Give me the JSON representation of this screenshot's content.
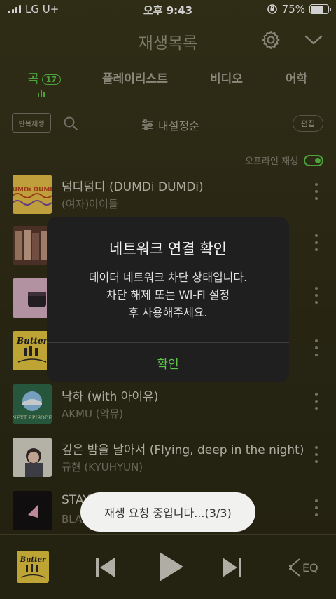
{
  "status_bar": {
    "carrier": "LG U+",
    "time": "오후 9:43",
    "battery_percent_text": "75%",
    "battery_level": 0.75
  },
  "header": {
    "title": "재생목록",
    "settings_icon": "gear-icon",
    "collapse_icon": "chevron-down-icon"
  },
  "tabs": [
    {
      "label": "곡",
      "count": "17",
      "active": true
    },
    {
      "label": "플레이리스트",
      "active": false
    },
    {
      "label": "비디오",
      "active": false
    },
    {
      "label": "어학",
      "active": false
    }
  ],
  "toolbar": {
    "repeat_label": "반복재생",
    "sort_label": "내설정순",
    "edit_label": "편집",
    "offline_label": "오프라인 재생",
    "offline_enabled": true
  },
  "songs": [
    {
      "title": "덤디덤디 (DUMDi DUMDi)",
      "artist": "(여자)아이들"
    },
    {
      "title": "",
      "artist": ""
    },
    {
      "title": "",
      "artist": ""
    },
    {
      "title": "",
      "artist": ""
    },
    {
      "title": "낙하 (with 아이유)",
      "artist": "AKMU (악뮤)"
    },
    {
      "title": "깊은 밤을 날아서 (Flying, deep in the night)",
      "artist": "규현 (KYUHYUN)"
    },
    {
      "title": "STAY",
      "artist": "BLA"
    }
  ],
  "album_art_text": {
    "song1": "DUMDi DUMDi",
    "song4": "Butter",
    "song5": "NEXT EPISODE",
    "player": "Butter"
  },
  "dialog": {
    "title": "네트워크 연결 확인",
    "message_lines": [
      "데이터 네트워크 차단 상태입니다.",
      "차단 해제 또는 Wi-Fi 설정",
      "후 사용해주세요."
    ],
    "ok_label": "확인"
  },
  "toast": {
    "text": "재생 요청 중입니다...(3/3)"
  },
  "player": {
    "eq_label": "EQ",
    "prev_icon": "previous-icon",
    "play_icon": "play-icon",
    "next_icon": "next-icon"
  },
  "colors": {
    "accent": "#5fc64a",
    "background": "#35321a",
    "dialog_bg": "#1f1f1f",
    "toast_bg": "#f1f1ef"
  }
}
